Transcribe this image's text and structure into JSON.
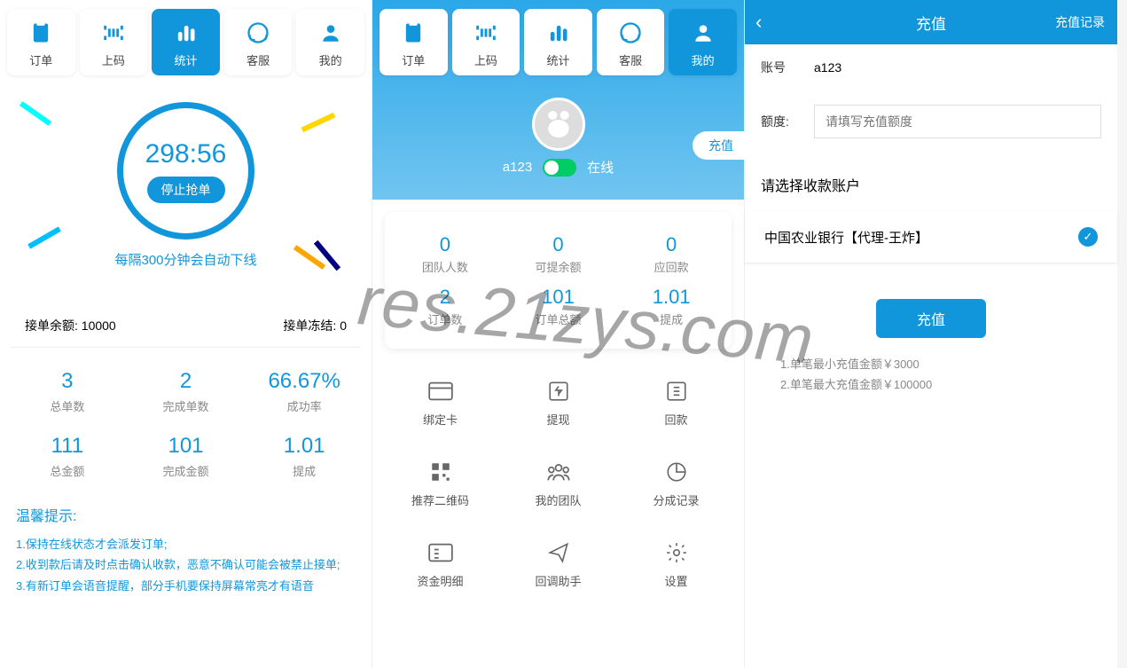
{
  "nav": {
    "labels": [
      "订单",
      "上码",
      "统计",
      "客服",
      "我的"
    ]
  },
  "p1": {
    "active_tab": 2,
    "timer": "298:56",
    "stop_label": "停止抢单",
    "auto_text": "每隔300分钟会自动下线",
    "balance_label": "接单余额:",
    "balance_value": "10000",
    "frozen_label": "接单冻结:",
    "frozen_value": "0",
    "stats": [
      {
        "v": "3",
        "l": "总单数"
      },
      {
        "v": "2",
        "l": "完成单数"
      },
      {
        "v": "66.67%",
        "l": "成功率"
      },
      {
        "v": "111",
        "l": "总金额"
      },
      {
        "v": "101",
        "l": "完成金额"
      },
      {
        "v": "1.01",
        "l": "提成"
      }
    ],
    "tips_title": "温馨提示:",
    "tips": [
      "1.保持在线状态才会派发订单;",
      "2.收到款后请及时点击确认收款，恶意不确认可能会被禁止接单;",
      "3.有新订单会语音提醒，部分手机要保持屏幕常亮才有语音"
    ]
  },
  "p2": {
    "active_tab": 4,
    "recharge_pill": "充值",
    "username": "a123",
    "status": "在线",
    "stats": [
      {
        "v": "0",
        "l": "团队人数"
      },
      {
        "v": "0",
        "l": "可提余额"
      },
      {
        "v": "0",
        "l": "应回款"
      },
      {
        "v": "2",
        "l": "订单数"
      },
      {
        "v": "101",
        "l": "订单总额"
      },
      {
        "v": "1.01",
        "l": "提成"
      }
    ],
    "menu": [
      "绑定卡",
      "提现",
      "回款",
      "推荐二维码",
      "我的团队",
      "分成记录",
      "资金明细",
      "回调助手",
      "设置"
    ]
  },
  "p3": {
    "title": "充值",
    "record_link": "充值记录",
    "account_label": "账号",
    "account_value": "a123",
    "amount_label": "额度:",
    "amount_placeholder": "请填写充值额度",
    "section_title": "请选择收款账户",
    "bank_option": "中国农业银行【代理-王炸】",
    "submit_label": "充值",
    "limits": [
      "1.单笔最小充值金额￥3000",
      "2.单笔最大充值金额￥100000"
    ]
  },
  "watermark": "res.21zys.com"
}
